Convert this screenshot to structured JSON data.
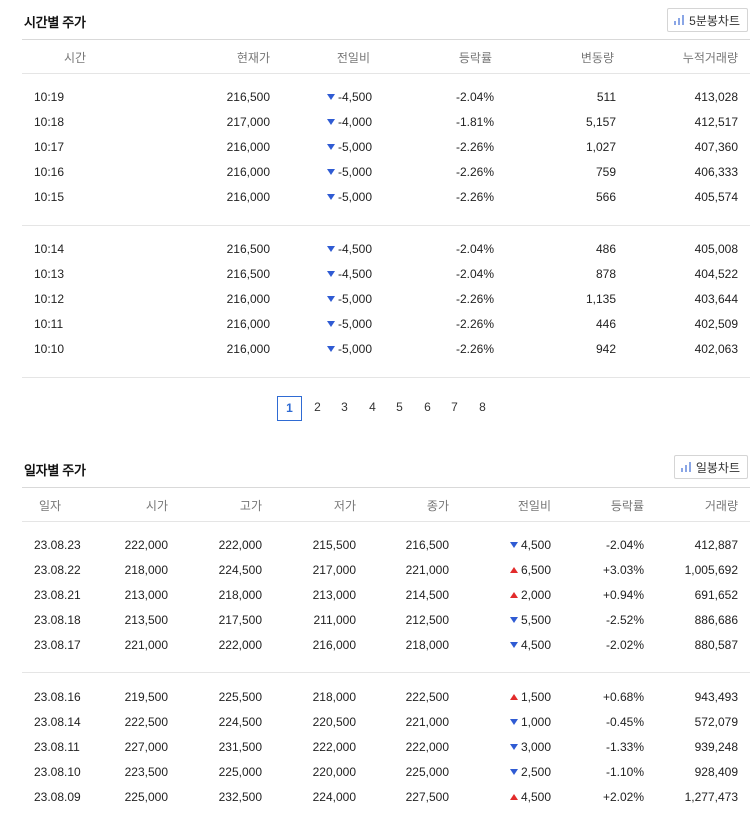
{
  "time_section": {
    "title": "시간별 주가",
    "chart_button": "5분봉차트",
    "headers": [
      "시간",
      "현재가",
      "전일비",
      "등락률",
      "변동량",
      "누적거래량"
    ],
    "rows": [
      [
        "10:19",
        "216,500",
        "4,500",
        "-2.04%",
        "511",
        "413,028"
      ],
      [
        "10:18",
        "217,000",
        "4,000",
        "-1.81%",
        "5,157",
        "412,517"
      ],
      [
        "10:17",
        "216,000",
        "5,000",
        "-2.26%",
        "1,027",
        "407,360"
      ],
      [
        "10:16",
        "216,000",
        "5,000",
        "-2.26%",
        "759",
        "406,333"
      ],
      [
        "10:15",
        "216,000",
        "5,000",
        "-2.26%",
        "566",
        "405,574"
      ],
      [
        "10:14",
        "216,500",
        "4,500",
        "-2.04%",
        "486",
        "405,008"
      ],
      [
        "10:13",
        "216,500",
        "4,500",
        "-2.04%",
        "878",
        "404,522"
      ],
      [
        "10:12",
        "216,000",
        "5,000",
        "-2.26%",
        "1,135",
        "403,644"
      ],
      [
        "10:11",
        "216,000",
        "5,000",
        "-2.26%",
        "446",
        "402,509"
      ],
      [
        "10:10",
        "216,000",
        "5,000",
        "-2.26%",
        "942",
        "402,063"
      ]
    ],
    "change_prefix": "-"
  },
  "pagination": {
    "pages": [
      "1",
      "2",
      "3",
      "4",
      "5",
      "6",
      "7",
      "8"
    ],
    "active": "1"
  },
  "daily_section": {
    "title": "일자별 주가",
    "chart_button": "일봉차트",
    "headers": [
      "일자",
      "시가",
      "고가",
      "저가",
      "종가",
      "전일비",
      "등락률",
      "거래량"
    ],
    "rows": [
      [
        "23.08.23",
        "222,000",
        "222,000",
        "215,500",
        "216,500",
        "4,500",
        "-2.04%",
        "412,887",
        "down"
      ],
      [
        "23.08.22",
        "218,000",
        "224,500",
        "217,000",
        "221,000",
        "6,500",
        "+3.03%",
        "1,005,692",
        "up"
      ],
      [
        "23.08.21",
        "213,000",
        "218,000",
        "213,000",
        "214,500",
        "2,000",
        "+0.94%",
        "691,652",
        "up"
      ],
      [
        "23.08.18",
        "213,500",
        "217,500",
        "211,000",
        "212,500",
        "5,500",
        "-2.52%",
        "886,686",
        "down"
      ],
      [
        "23.08.17",
        "221,000",
        "222,000",
        "216,000",
        "218,000",
        "4,500",
        "-2.02%",
        "880,587",
        "down"
      ],
      [
        "23.08.16",
        "219,500",
        "225,500",
        "218,000",
        "222,500",
        "1,500",
        "+0.68%",
        "943,493",
        "up"
      ],
      [
        "23.08.14",
        "222,500",
        "224,500",
        "220,500",
        "221,000",
        "1,000",
        "-0.45%",
        "572,079",
        "down"
      ],
      [
        "23.08.11",
        "227,000",
        "231,500",
        "222,000",
        "222,000",
        "3,000",
        "-1.33%",
        "939,248",
        "down"
      ],
      [
        "23.08.10",
        "223,500",
        "225,000",
        "220,000",
        "225,000",
        "2,500",
        "-1.10%",
        "928,409",
        "down"
      ],
      [
        "23.08.09",
        "225,000",
        "232,500",
        "224,000",
        "227,500",
        "4,500",
        "+2.02%",
        "1,277,473",
        "up"
      ]
    ]
  },
  "colors": {
    "down": "#2f5bd3",
    "up": "#e22b2b",
    "active_page": "#2f6bd3"
  },
  "icons": {
    "chart_button_icon": "bar-chart-icon"
  }
}
